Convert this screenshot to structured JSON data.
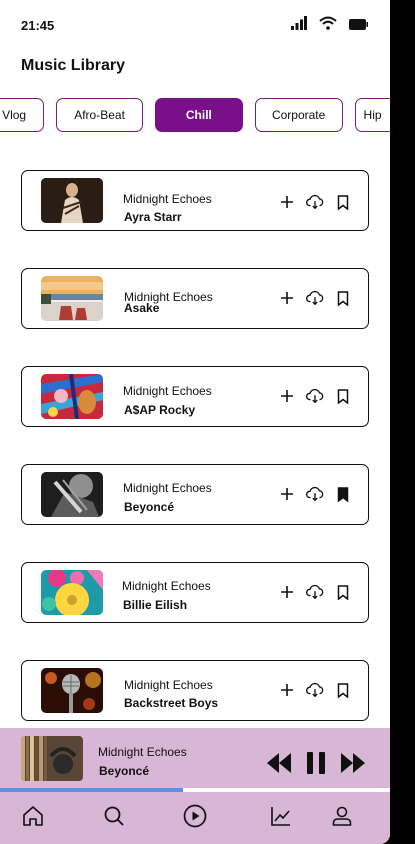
{
  "status": {
    "time": "21:45"
  },
  "page": {
    "title": "Music Library"
  },
  "chips": [
    {
      "label": "Vlog",
      "active": false
    },
    {
      "label": "Afro-Beat",
      "active": false
    },
    {
      "label": "Chill",
      "active": true
    },
    {
      "label": "Corporate",
      "active": false
    },
    {
      "label": "Hip",
      "active": false
    }
  ],
  "tracks": [
    {
      "song": "Midnight Echoes",
      "artist": "Ayra Starr",
      "bookmarked": false
    },
    {
      "song": "Midnight Echoes",
      "artist": "Asake",
      "bookmarked": false
    },
    {
      "song": "Midnight Echoes",
      "artist": "A$AP Rocky",
      "bookmarked": false
    },
    {
      "song": "Midnight Echoes",
      "artist": "Beyoncé",
      "bookmarked": true
    },
    {
      "song": "Midnight Echoes",
      "artist": "Billie Eilish",
      "bookmarked": false
    },
    {
      "song": "Midnight Echoes",
      "artist": "Backstreet Boys",
      "bookmarked": false
    }
  ],
  "now_playing": {
    "song": "Midnight Echoes",
    "artist": "Beyoncé",
    "progress": 0.47
  },
  "colors": {
    "accent": "#7a0f8a",
    "player_bg": "#d8b6d6",
    "progress": "#5b8fe8"
  },
  "nav": [
    "home-icon",
    "search-icon",
    "play-circle-icon",
    "chart-icon",
    "profile-icon"
  ]
}
